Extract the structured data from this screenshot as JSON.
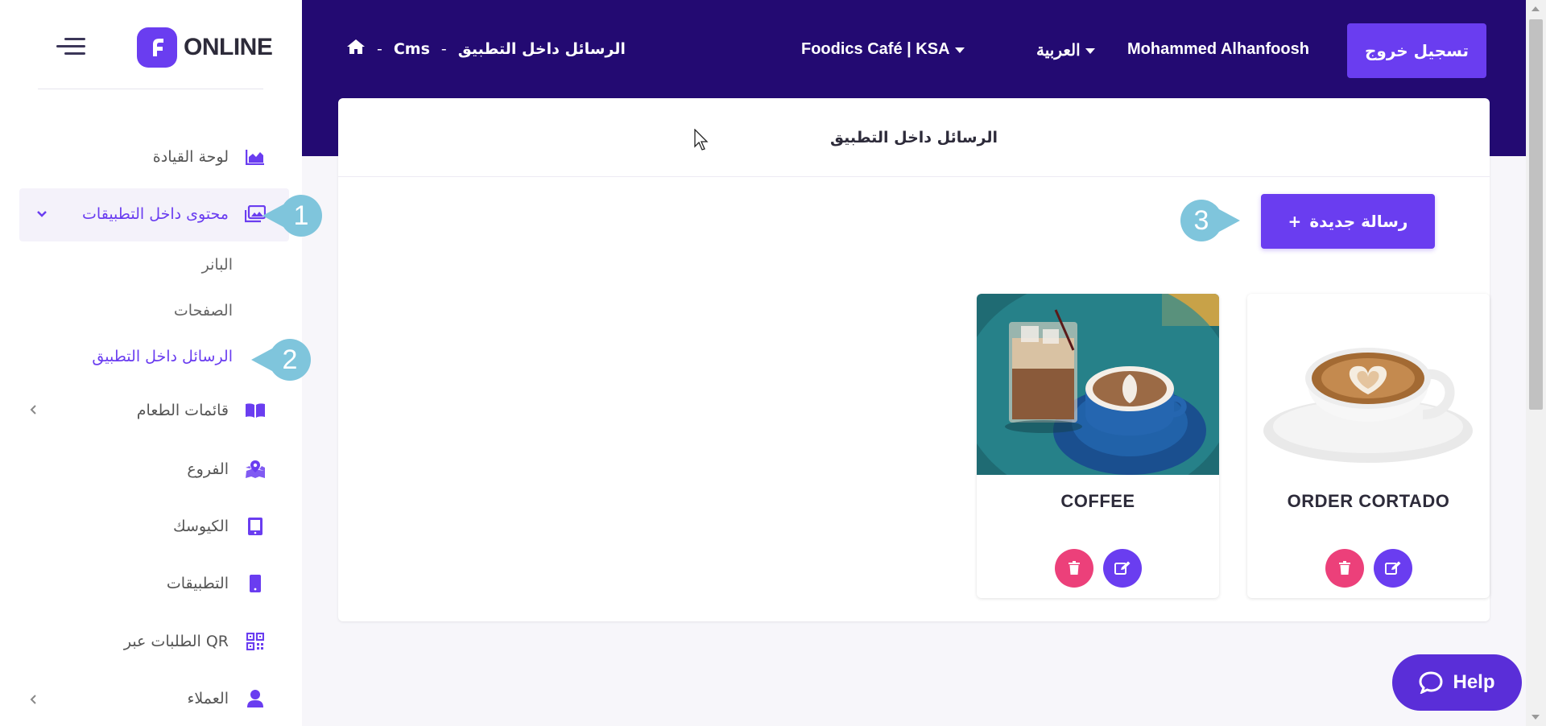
{
  "sidebar": {
    "logo_text": "ONLINE",
    "items": [
      {
        "label": "لوحة القيادة",
        "icon": "chart-area-icon"
      },
      {
        "label": "محتوى داخل التطبيقات",
        "icon": "images-icon"
      },
      {
        "label": "قائمات الطعام",
        "icon": "book-open-icon"
      },
      {
        "label": "الفروع",
        "icon": "map-marked-icon"
      },
      {
        "label": "الكيوسك",
        "icon": "tablet-icon"
      },
      {
        "label": "التطبيقات",
        "icon": "mobile-icon"
      },
      {
        "label": "الطلبات عبر QR",
        "icon": "qrcode-icon"
      },
      {
        "label": "العملاء",
        "icon": "user-icon"
      }
    ],
    "sub_items": [
      {
        "label": "البانر"
      },
      {
        "label": "الصفحات"
      },
      {
        "label": "الرسائل داخل التطبيق"
      }
    ]
  },
  "callouts": [
    "1",
    "2",
    "3"
  ],
  "header": {
    "breadcrumb": {
      "section": "Cms",
      "current": "الرسائل داخل التطبيق",
      "separator": "-"
    },
    "business": "Foodics Café | KSA",
    "language": "العربية",
    "user_name": "Mohammed Alhanfoosh",
    "logout_label": "تسجيل خروج"
  },
  "main": {
    "title": "الرسائل داخل التطبيق",
    "new_button": "رسالة جديدة",
    "new_button_icon": "+",
    "messages": [
      {
        "name": "ORDER CORTADO"
      },
      {
        "name": "COFFEE"
      }
    ]
  },
  "help": {
    "label": "Help"
  },
  "colors": {
    "primary": "#6a3df0",
    "header_bg": "#230a72",
    "delete": "#ec407a",
    "callout": "#7fc5dc"
  }
}
